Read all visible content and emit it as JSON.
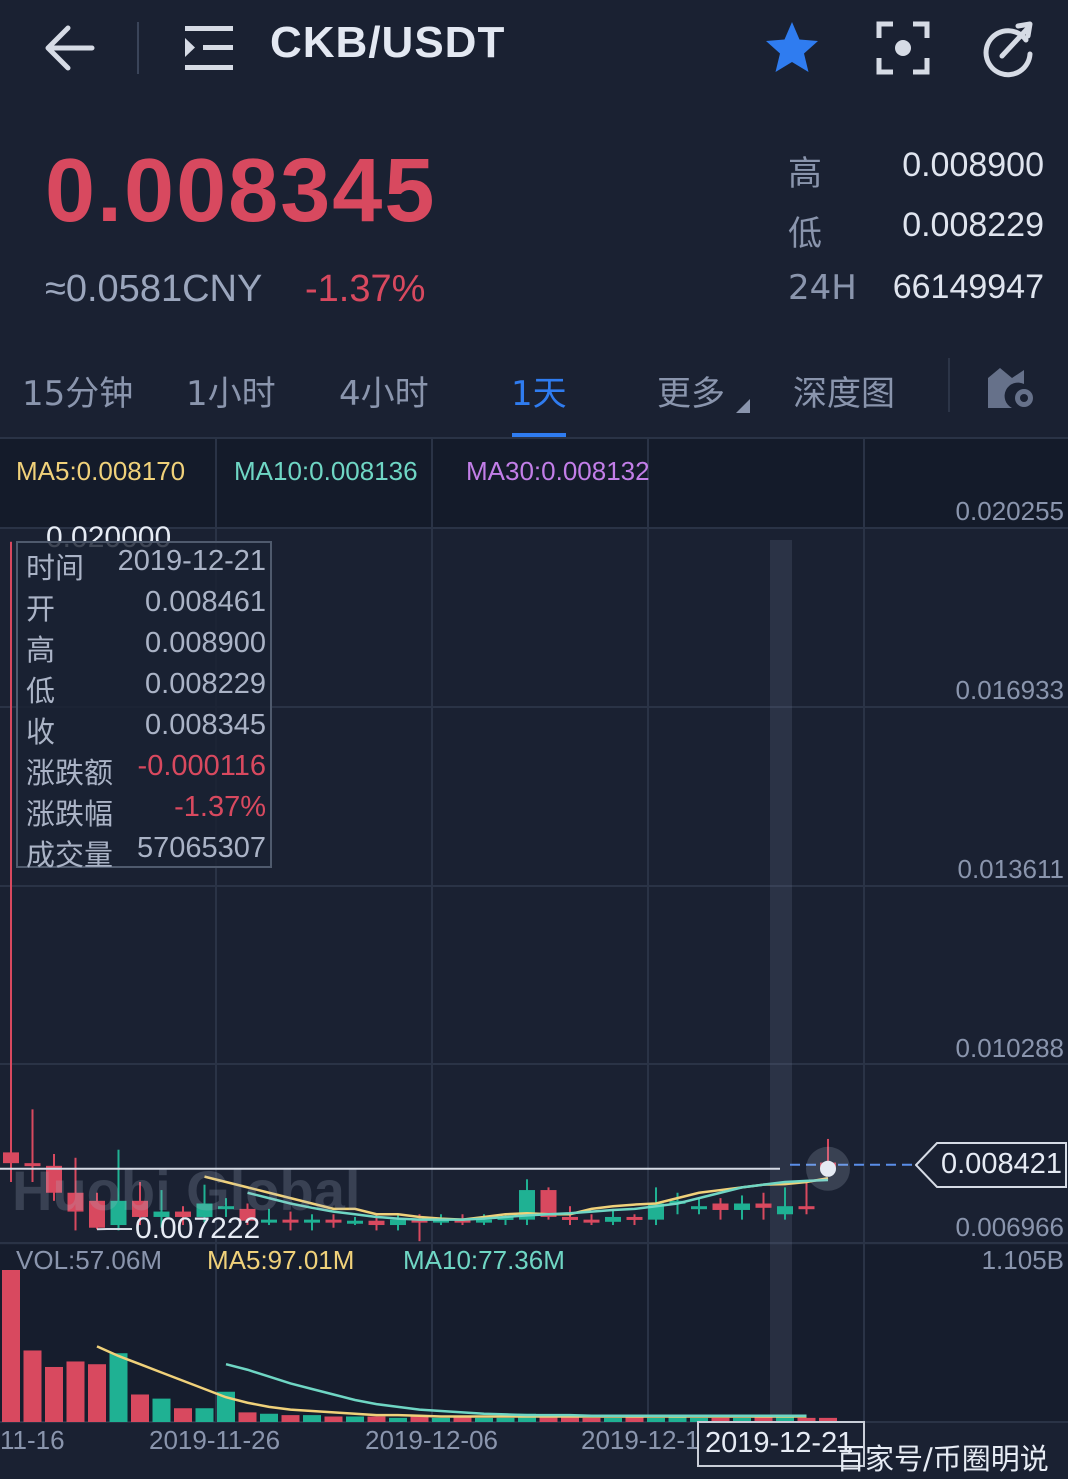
{
  "header": {
    "pair": "CKB/USDT"
  },
  "ticker": {
    "price": "0.008345",
    "cny": "≈0.0581CNY",
    "change": "-1.37%",
    "stats": [
      {
        "label": "高",
        "value": "0.008900"
      },
      {
        "label": "低",
        "value": "0.008229"
      },
      {
        "label": "24H",
        "value": "66149947"
      }
    ]
  },
  "tabs": [
    {
      "label": "15分钟"
    },
    {
      "label": "1小时"
    },
    {
      "label": "4小时"
    },
    {
      "label": "1天",
      "active": true
    },
    {
      "label": "更多"
    },
    {
      "label": "深度图"
    }
  ],
  "ma": {
    "ma5": "MA5:0.008170",
    "ma10": "MA10:0.008136",
    "ma30": "MA30:0.008132"
  },
  "colors": {
    "up": "#1fb193",
    "down": "#d8495f",
    "ma5": "#f0d17a",
    "ma10": "#6fd6c4",
    "ma30": "#c27ee8",
    "accent": "#2f7cf0"
  },
  "y_axis": [
    "0.020255",
    "0.016933",
    "0.013611",
    "0.010288",
    "0.006966"
  ],
  "vol_axis_max": "1.105B",
  "current_price_tag": "0.008421",
  "peak_label": "0.020000",
  "low_label": "0.007222",
  "watermark": "Huobi Global",
  "tooltip": [
    {
      "label": "时间",
      "value": "2019-12-21"
    },
    {
      "label": "开",
      "value": "0.008461"
    },
    {
      "label": "高",
      "value": "0.008900"
    },
    {
      "label": "低",
      "value": "0.008229"
    },
    {
      "label": "收",
      "value": "0.008345"
    },
    {
      "label": "涨跌额",
      "value": "-0.000116",
      "red": true
    },
    {
      "label": "涨跌幅",
      "value": "-1.37%",
      "red": true
    },
    {
      "label": "成交量",
      "value": "57065307"
    }
  ],
  "volume": {
    "vol": "VOL:57.06M",
    "ma5": "MA5:97.01M",
    "ma10": "MA10:77.36M"
  },
  "x_axis": [
    "11-16",
    "2019-11-26",
    "2019-12-06",
    "2019-12-1"
  ],
  "selected_date": "2019-12-21",
  "source_mark": "百家号/币圈明说",
  "chart_data": {
    "type": "candlestick",
    "ylim": [
      0.006966,
      0.020255
    ],
    "candles": [
      {
        "o": 0.00865,
        "c": 0.00845,
        "h": 0.02,
        "l": 0.0081
      },
      {
        "o": 0.00845,
        "c": 0.00842,
        "h": 0.00945,
        "l": 0.0081
      },
      {
        "o": 0.0084,
        "c": 0.0079,
        "h": 0.00862,
        "l": 0.00775
      },
      {
        "o": 0.0079,
        "c": 0.00755,
        "h": 0.00855,
        "l": 0.0072
      },
      {
        "o": 0.00775,
        "c": 0.00725,
        "h": 0.0079,
        "l": 0.007222
      },
      {
        "o": 0.0073,
        "c": 0.00775,
        "h": 0.0087,
        "l": 0.0072
      },
      {
        "o": 0.00775,
        "c": 0.00745,
        "h": 0.0081,
        "l": 0.0073
      },
      {
        "o": 0.00745,
        "c": 0.00755,
        "h": 0.00795,
        "l": 0.00725
      },
      {
        "o": 0.00755,
        "c": 0.00745,
        "h": 0.00765,
        "l": 0.0073
      },
      {
        "o": 0.00745,
        "c": 0.0077,
        "h": 0.00805,
        "l": 0.00735
      },
      {
        "o": 0.0076,
        "c": 0.00765,
        "h": 0.0078,
        "l": 0.00745
      },
      {
        "o": 0.0076,
        "c": 0.00738,
        "h": 0.0077,
        "l": 0.0073
      },
      {
        "o": 0.00738,
        "c": 0.0074,
        "h": 0.0076,
        "l": 0.0073
      },
      {
        "o": 0.0074,
        "c": 0.00735,
        "h": 0.00755,
        "l": 0.0072
      },
      {
        "o": 0.00735,
        "c": 0.0074,
        "h": 0.0075,
        "l": 0.0072
      },
      {
        "o": 0.0074,
        "c": 0.00735,
        "h": 0.0075,
        "l": 0.00725
      },
      {
        "o": 0.00735,
        "c": 0.00738,
        "h": 0.00745,
        "l": 0.0073
      },
      {
        "o": 0.00738,
        "c": 0.0073,
        "h": 0.0075,
        "l": 0.0072
      },
      {
        "o": 0.0073,
        "c": 0.0074,
        "h": 0.0075,
        "l": 0.0072
      },
      {
        "o": 0.0074,
        "c": 0.00735,
        "h": 0.0075,
        "l": 0.007
      },
      {
        "o": 0.00735,
        "c": 0.0074,
        "h": 0.0075,
        "l": 0.0073
      },
      {
        "o": 0.0074,
        "c": 0.00738,
        "h": 0.0075,
        "l": 0.0073
      },
      {
        "o": 0.00738,
        "c": 0.0074,
        "h": 0.0075,
        "l": 0.0073
      },
      {
        "o": 0.0074,
        "c": 0.00745,
        "h": 0.0075,
        "l": 0.0073
      },
      {
        "o": 0.0074,
        "c": 0.00795,
        "h": 0.00815,
        "l": 0.0073
      },
      {
        "o": 0.00795,
        "c": 0.00745,
        "h": 0.008,
        "l": 0.0074
      },
      {
        "o": 0.00745,
        "c": 0.0074,
        "h": 0.00765,
        "l": 0.0073
      },
      {
        "o": 0.0074,
        "c": 0.00736,
        "h": 0.0075,
        "l": 0.0073
      },
      {
        "o": 0.00736,
        "c": 0.00745,
        "h": 0.0076,
        "l": 0.0073
      },
      {
        "o": 0.00745,
        "c": 0.0074,
        "h": 0.0075,
        "l": 0.0073
      },
      {
        "o": 0.0074,
        "c": 0.0077,
        "h": 0.008,
        "l": 0.0073
      },
      {
        "o": 0.0077,
        "c": 0.00775,
        "h": 0.0079,
        "l": 0.0075
      },
      {
        "o": 0.00765,
        "c": 0.00765,
        "h": 0.0078,
        "l": 0.0075
      },
      {
        "o": 0.0077,
        "c": 0.00758,
        "h": 0.0078,
        "l": 0.0074
      },
      {
        "o": 0.00758,
        "c": 0.0077,
        "h": 0.00785,
        "l": 0.0074
      },
      {
        "o": 0.0077,
        "c": 0.00762,
        "h": 0.0079,
        "l": 0.0074
      },
      {
        "o": 0.0075,
        "c": 0.00765,
        "h": 0.008,
        "l": 0.0074
      },
      {
        "o": 0.00765,
        "c": 0.00762,
        "h": 0.0081,
        "l": 0.0075
      },
      {
        "o": 0.008461,
        "c": 0.008345,
        "h": 0.0089,
        "l": 0.008229
      }
    ],
    "ma5": [
      0.0082,
      0.0081,
      0.008,
      0.0079,
      0.0078,
      0.0077,
      0.0076,
      0.0076,
      0.0075,
      0.0075,
      0.00745,
      0.00742,
      0.0074,
      0.00745,
      0.0075,
      0.00752,
      0.0075,
      0.0075,
      0.0076,
      0.00765,
      0.00768,
      0.0077,
      0.0078,
      0.0079,
      0.00795,
      0.008,
      0.00805,
      0.00806,
      0.0081,
      0.00817
    ],
    "ma10": [
      0.0079,
      0.0078,
      0.0077,
      0.00762,
      0.00755,
      0.0075,
      0.00745,
      0.00742,
      0.0074,
      0.0074,
      0.0074,
      0.00742,
      0.00745,
      0.00748,
      0.0075,
      0.00752,
      0.00755,
      0.00758,
      0.0076,
      0.00765,
      0.0077,
      0.0078,
      0.0079,
      0.008,
      0.00805,
      0.0081,
      0.00812,
      0.008136
    ],
    "volume": [
      1.105,
      0.52,
      0.4,
      0.44,
      0.42,
      0.5,
      0.2,
      0.17,
      0.1,
      0.1,
      0.22,
      0.07,
      0.06,
      0.05,
      0.05,
      0.04,
      0.04,
      0.04,
      0.03,
      0.04,
      0.03,
      0.04,
      0.03,
      0.03,
      0.06,
      0.04,
      0.04,
      0.03,
      0.03,
      0.05,
      0.03,
      0.04,
      0.03,
      0.03,
      0.03,
      0.04,
      0.05,
      0.03,
      0.03
    ],
    "vol_ylim": [
      0,
      1.105
    ]
  }
}
